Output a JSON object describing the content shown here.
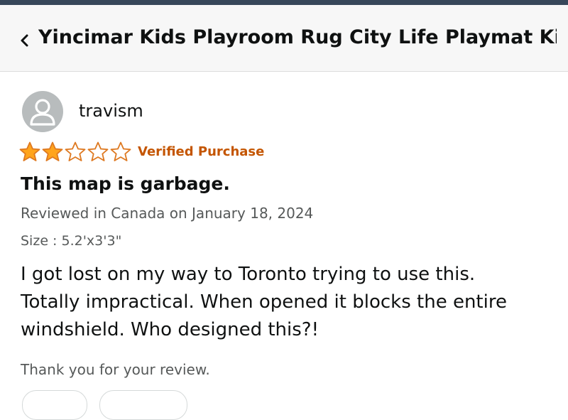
{
  "header": {
    "title": "Yincimar Kids Playroom Rug City Life Playmat Kid..."
  },
  "review": {
    "username": "travism",
    "rating": 2,
    "rating_max": 5,
    "verified_label": "Verified Purchase",
    "title": "This map is garbage.",
    "reviewed_line": "Reviewed in Canada on January 18, 2024",
    "size_line": "Size : 5.2'x3'3\"",
    "body_lines": [
      "I got lost on my way to Toronto trying to use this.",
      "Totally impractical. When opened it blocks the entire",
      "windshield. Who designed this?!"
    ],
    "thank_you": "Thank you for your review."
  },
  "colors": {
    "star_fill": "#ffa41c",
    "star_outline": "#de7921",
    "verified": "#c45500",
    "top_bar": "#37475a"
  },
  "icons": {
    "back": "chevron-left-icon",
    "avatar": "user-avatar-icon",
    "star": "star-icon"
  }
}
